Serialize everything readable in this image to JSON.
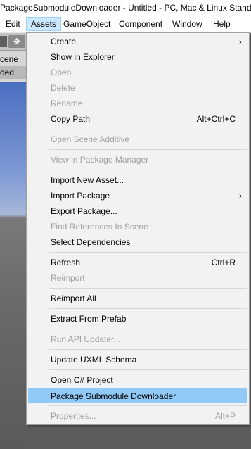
{
  "title": "PackageSubmoduleDownloader - Untitled - PC, Mac & Linux Standalone",
  "menubar": [
    {
      "label": "Edit",
      "active": false
    },
    {
      "label": "Assets",
      "active": true
    },
    {
      "label": "GameObject",
      "active": false
    },
    {
      "label": "Component",
      "active": false
    },
    {
      "label": "Window",
      "active": false
    },
    {
      "label": "Help",
      "active": false
    }
  ],
  "background": {
    "move_tool_glyph": "✥",
    "hierarchy_row_1": "cene",
    "hierarchy_row_2": "ded"
  },
  "dropdown": {
    "items": [
      {
        "label": "Create",
        "shortcut": "",
        "submenu": true,
        "disabled": false
      },
      {
        "label": "Show in Explorer",
        "shortcut": "",
        "submenu": false,
        "disabled": false
      },
      {
        "label": "Open",
        "shortcut": "",
        "submenu": false,
        "disabled": true
      },
      {
        "label": "Delete",
        "shortcut": "",
        "submenu": false,
        "disabled": true
      },
      {
        "label": "Rename",
        "shortcut": "",
        "submenu": false,
        "disabled": true
      },
      {
        "label": "Copy Path",
        "shortcut": "Alt+Ctrl+C",
        "submenu": false,
        "disabled": false
      },
      {
        "label": "Open Scene Additive",
        "shortcut": "",
        "submenu": false,
        "disabled": true
      },
      {
        "label": "View in Package Manager",
        "shortcut": "",
        "submenu": false,
        "disabled": true
      },
      {
        "label": "Import New Asset...",
        "shortcut": "",
        "submenu": false,
        "disabled": false
      },
      {
        "label": "Import Package",
        "shortcut": "",
        "submenu": true,
        "disabled": false
      },
      {
        "label": "Export Package...",
        "shortcut": "",
        "submenu": false,
        "disabled": false
      },
      {
        "label": "Find References In Scene",
        "shortcut": "",
        "submenu": false,
        "disabled": true
      },
      {
        "label": "Select Dependencies",
        "shortcut": "",
        "submenu": false,
        "disabled": false
      },
      {
        "label": "Refresh",
        "shortcut": "Ctrl+R",
        "submenu": false,
        "disabled": false
      },
      {
        "label": "Reimport",
        "shortcut": "",
        "submenu": false,
        "disabled": true
      },
      {
        "label": "Reimport All",
        "shortcut": "",
        "submenu": false,
        "disabled": false
      },
      {
        "label": "Extract From Prefab",
        "shortcut": "",
        "submenu": false,
        "disabled": false
      },
      {
        "label": "Run API Updater...",
        "shortcut": "",
        "submenu": false,
        "disabled": true
      },
      {
        "label": "Update UXML Schema",
        "shortcut": "",
        "submenu": false,
        "disabled": false
      },
      {
        "label": "Open C# Project",
        "shortcut": "",
        "submenu": false,
        "disabled": false
      },
      {
        "label": "Package Submodule Downloader",
        "shortcut": "",
        "submenu": false,
        "disabled": false,
        "highlighted": true
      },
      {
        "label": "Properties...",
        "shortcut": "Alt+P",
        "submenu": false,
        "disabled": true
      }
    ],
    "submenu_arrow": "›"
  }
}
